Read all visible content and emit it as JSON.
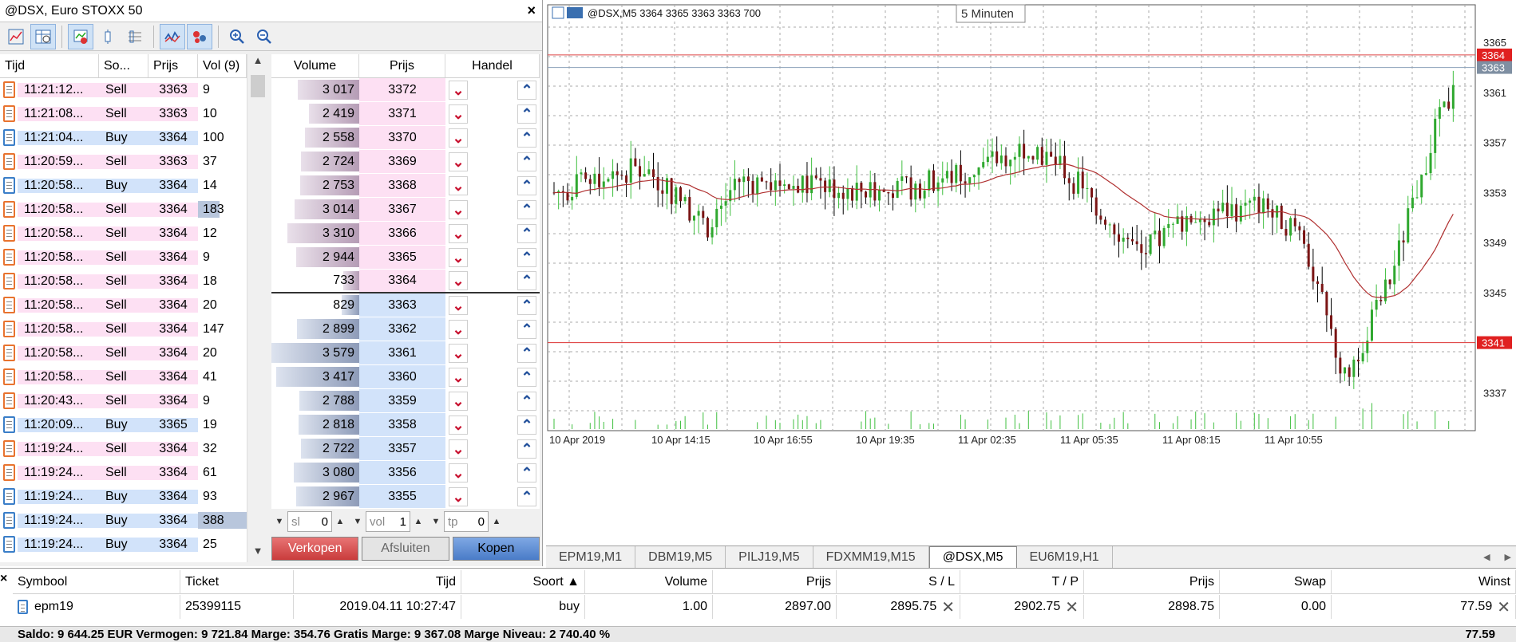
{
  "window_title": "@DSX, Euro STOXX 50",
  "trades": {
    "headers": [
      "Tijd",
      "So...",
      "Prijs",
      "Vol (9)"
    ],
    "rows": [
      {
        "time": "11:21:12...",
        "side": "Sell",
        "price": "3363",
        "vol": "9",
        "bar": 0
      },
      {
        "time": "11:21:08...",
        "side": "Sell",
        "price": "3363",
        "vol": "10",
        "bar": 0
      },
      {
        "time": "11:21:04...",
        "side": "Buy",
        "price": "3364",
        "vol": "100",
        "bar": 0
      },
      {
        "time": "11:20:59...",
        "side": "Sell",
        "price": "3363",
        "vol": "37",
        "bar": 0
      },
      {
        "time": "11:20:58...",
        "side": "Buy",
        "price": "3364",
        "vol": "14",
        "bar": 0
      },
      {
        "time": "11:20:58...",
        "side": "Sell",
        "price": "3364",
        "vol": "183",
        "bar": 0.45
      },
      {
        "time": "11:20:58...",
        "side": "Sell",
        "price": "3364",
        "vol": "12",
        "bar": 0
      },
      {
        "time": "11:20:58...",
        "side": "Sell",
        "price": "3364",
        "vol": "9",
        "bar": 0
      },
      {
        "time": "11:20:58...",
        "side": "Sell",
        "price": "3364",
        "vol": "18",
        "bar": 0
      },
      {
        "time": "11:20:58...",
        "side": "Sell",
        "price": "3364",
        "vol": "20",
        "bar": 0
      },
      {
        "time": "11:20:58...",
        "side": "Sell",
        "price": "3364",
        "vol": "147",
        "bar": 0
      },
      {
        "time": "11:20:58...",
        "side": "Sell",
        "price": "3364",
        "vol": "20",
        "bar": 0
      },
      {
        "time": "11:20:58...",
        "side": "Sell",
        "price": "3364",
        "vol": "41",
        "bar": 0
      },
      {
        "time": "11:20:43...",
        "side": "Sell",
        "price": "3364",
        "vol": "9",
        "bar": 0
      },
      {
        "time": "11:20:09...",
        "side": "Buy",
        "price": "3365",
        "vol": "19",
        "bar": 0
      },
      {
        "time": "11:19:24...",
        "side": "Sell",
        "price": "3364",
        "vol": "32",
        "bar": 0
      },
      {
        "time": "11:19:24...",
        "side": "Sell",
        "price": "3364",
        "vol": "61",
        "bar": 0
      },
      {
        "time": "11:19:24...",
        "side": "Buy",
        "price": "3364",
        "vol": "93",
        "bar": 0
      },
      {
        "time": "11:19:24...",
        "side": "Buy",
        "price": "3364",
        "vol": "388",
        "bar": 1.0
      },
      {
        "time": "11:19:24...",
        "side": "Buy",
        "price": "3364",
        "vol": "25",
        "bar": 0
      }
    ]
  },
  "dom": {
    "headers": {
      "volume": "Volume",
      "price": "Prijs",
      "trade": "Handel"
    },
    "rows": [
      {
        "volume": "3 017",
        "price": "3372",
        "type": "ask",
        "share": 0.7
      },
      {
        "volume": "2 419",
        "price": "3371",
        "type": "ask",
        "share": 0.57
      },
      {
        "volume": "2 558",
        "price": "3370",
        "type": "ask",
        "share": 0.62
      },
      {
        "volume": "2 724",
        "price": "3369",
        "type": "ask",
        "share": 0.66
      },
      {
        "volume": "2 753",
        "price": "3368",
        "type": "ask",
        "share": 0.67
      },
      {
        "volume": "3 014",
        "price": "3367",
        "type": "ask",
        "share": 0.74
      },
      {
        "volume": "3 310",
        "price": "3366",
        "type": "ask",
        "share": 0.82
      },
      {
        "volume": "2 944",
        "price": "3365",
        "type": "ask",
        "share": 0.72
      },
      {
        "volume": "733",
        "price": "3364",
        "type": "ask",
        "share": 0.18
      },
      {
        "volume": "829",
        "price": "3363",
        "type": "bid",
        "share": 0.2
      },
      {
        "volume": "2 899",
        "price": "3362",
        "type": "bid",
        "share": 0.71
      },
      {
        "volume": "3 579",
        "price": "3361",
        "type": "bid",
        "share": 1.0
      },
      {
        "volume": "3 417",
        "price": "3360",
        "type": "bid",
        "share": 0.95
      },
      {
        "volume": "2 788",
        "price": "3359",
        "type": "bid",
        "share": 0.68
      },
      {
        "volume": "2 818",
        "price": "3358",
        "type": "bid",
        "share": 0.69
      },
      {
        "volume": "2 722",
        "price": "3357",
        "type": "bid",
        "share": 0.66
      },
      {
        "volume": "3 080",
        "price": "3356",
        "type": "bid",
        "share": 0.75
      },
      {
        "volume": "2 967",
        "price": "3355",
        "type": "bid",
        "share": 0.72
      }
    ]
  },
  "order": {
    "sl_placeholder": "sl",
    "sl_value": "0",
    "vol_placeholder": "vol",
    "vol_value": "1",
    "tp_placeholder": "tp",
    "tp_value": "0",
    "sell_label": "Verkopen",
    "close_label": "Afsluiten",
    "buy_label": "Kopen"
  },
  "chart": {
    "header": "@DSX,M5  3364 3365 3363 3363  700",
    "timeframe_tip": "5 Minuten",
    "price_labels": [
      "3365",
      "3361",
      "3357",
      "3353",
      "3349",
      "3345",
      "3337"
    ],
    "price_values": [
      3365,
      3361,
      3357,
      3353,
      3349,
      3345,
      3337
    ],
    "bid_tag": "3364",
    "ask_tag": "3363",
    "level_tag": "3341",
    "bid_value": 3364,
    "ask_value": 3363,
    "level_value": 3341,
    "time_labels": [
      "10 Apr 2019",
      "10 Apr 14:15",
      "10 Apr 16:55",
      "10 Apr 19:35",
      "11 Apr 02:35",
      "11 Apr 05:35",
      "11 Apr 08:15",
      "11 Apr 10:55"
    ],
    "colors": {
      "up": "#3fbf3f",
      "down": "#000000",
      "bull_body": "#2fa82f",
      "bear_body": "#7a1414",
      "ma": "#b03030",
      "bidline": "#d44",
      "askline": "#8aa0b8"
    }
  },
  "tabs": [
    "EPM19,M1",
    "DBM19,M5",
    "PILJ19,M5",
    "FDXMM19,M15",
    "@DSX,M5",
    "EU6M19,H1"
  ],
  "active_tab": "@DSX,M5",
  "positions": {
    "headers": [
      "Symbool",
      "Ticket",
      "Tijd",
      "Soort ▲",
      "Volume",
      "Prijs",
      "S / L",
      "T / P",
      "Prijs",
      "Swap",
      "Winst"
    ],
    "row": {
      "symbol": "epm19",
      "ticket": "25399115",
      "time": "2019.04.11 10:27:47",
      "type": "buy",
      "volume": "1.00",
      "price": "2897.00",
      "sl": "2895.75",
      "tp": "2902.75",
      "cur_price": "2898.75",
      "swap": "0.00",
      "profit": "77.59"
    },
    "summary": "Saldo: 9 644.25 EUR  Vermogen: 9 721.84  Marge: 354.76  Gratis Marge: 9 367.08  Marge Niveau: 2 740.40 %",
    "total": "77.59"
  }
}
